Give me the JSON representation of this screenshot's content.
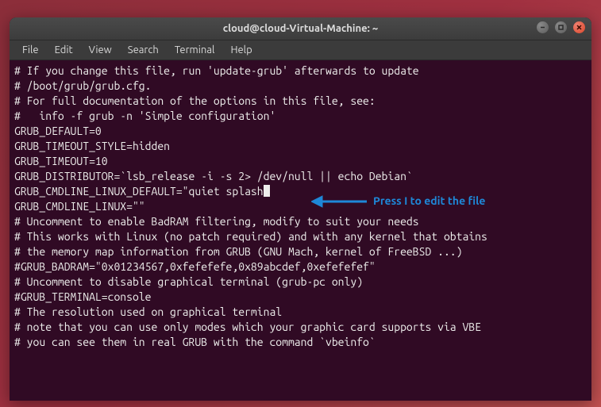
{
  "window": {
    "title": "cloud@cloud-Virtual-Machine: ~"
  },
  "menu": {
    "file": "File",
    "edit": "Edit",
    "view": "View",
    "search": "Search",
    "terminal": "Terminal",
    "help": "Help"
  },
  "lines": {
    "l0": "# If you change this file, run 'update-grub' afterwards to update",
    "l1": "# /boot/grub/grub.cfg.",
    "l2": "# For full documentation of the options in this file, see:",
    "l3": "#   info -f grub -n 'Simple configuration'",
    "l4": "",
    "l5": "GRUB_DEFAULT=0",
    "l6": "GRUB_TIMEOUT_STYLE=hidden",
    "l7": "GRUB_TIMEOUT=10",
    "l8": "GRUB_DISTRIBUTOR=`lsb_release -i -s 2> /dev/null || echo Debian`",
    "l9a": "GRUB_CMDLINE_LINUX_DEFAULT=\"quiet splash",
    "l9b": "",
    "l10": "GRUB_CMDLINE_LINUX=\"\"",
    "l11": "",
    "l12": "# Uncomment to enable BadRAM filtering, modify to suit your needs",
    "l13": "# This works with Linux (no patch required) and with any kernel that obtains",
    "l14": "# the memory map information from GRUB (GNU Mach, kernel of FreeBSD ...)",
    "l15": "#GRUB_BADRAM=\"0x01234567,0xfefefefe,0x89abcdef,0xefefefef\"",
    "l16": "",
    "l17": "# Uncomment to disable graphical terminal (grub-pc only)",
    "l18": "#GRUB_TERMINAL=console",
    "l19": "",
    "l20": "# The resolution used on graphical terminal",
    "l21": "# note that you can use only modes which your graphic card supports via VBE",
    "l22": "# you can see them in real GRUB with the command `vbeinfo`"
  },
  "annotation": {
    "text": "Press I to edit the file"
  }
}
